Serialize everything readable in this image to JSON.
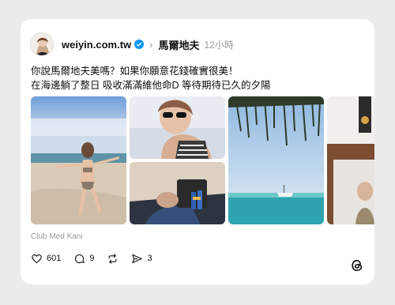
{
  "post": {
    "username": "weiyin.com.tw",
    "divider": "›",
    "topic": "馬爾地夫",
    "time": "12小時",
    "text_line1": "你說馬爾地夫美嗎？如果你願意花錢確實很美！",
    "text_line2": "在海邊躺了整日 吸收滿滿維他命D 等待期待已久的夕陽",
    "location": "Club Med Kani"
  },
  "actions": {
    "likes": "601",
    "replies": "9",
    "shares": "3"
  },
  "icons": {
    "verified": "verified-badge-icon",
    "like": "heart-icon",
    "reply": "comment-bubble-icon",
    "repost": "repost-arrows-icon",
    "share": "send-icon",
    "brand": "threads-logo-icon"
  },
  "colors": {
    "background": "#ececec",
    "card": "#ffffff",
    "verified": "#0095f6",
    "text": "#111111",
    "muted": "#999999"
  }
}
